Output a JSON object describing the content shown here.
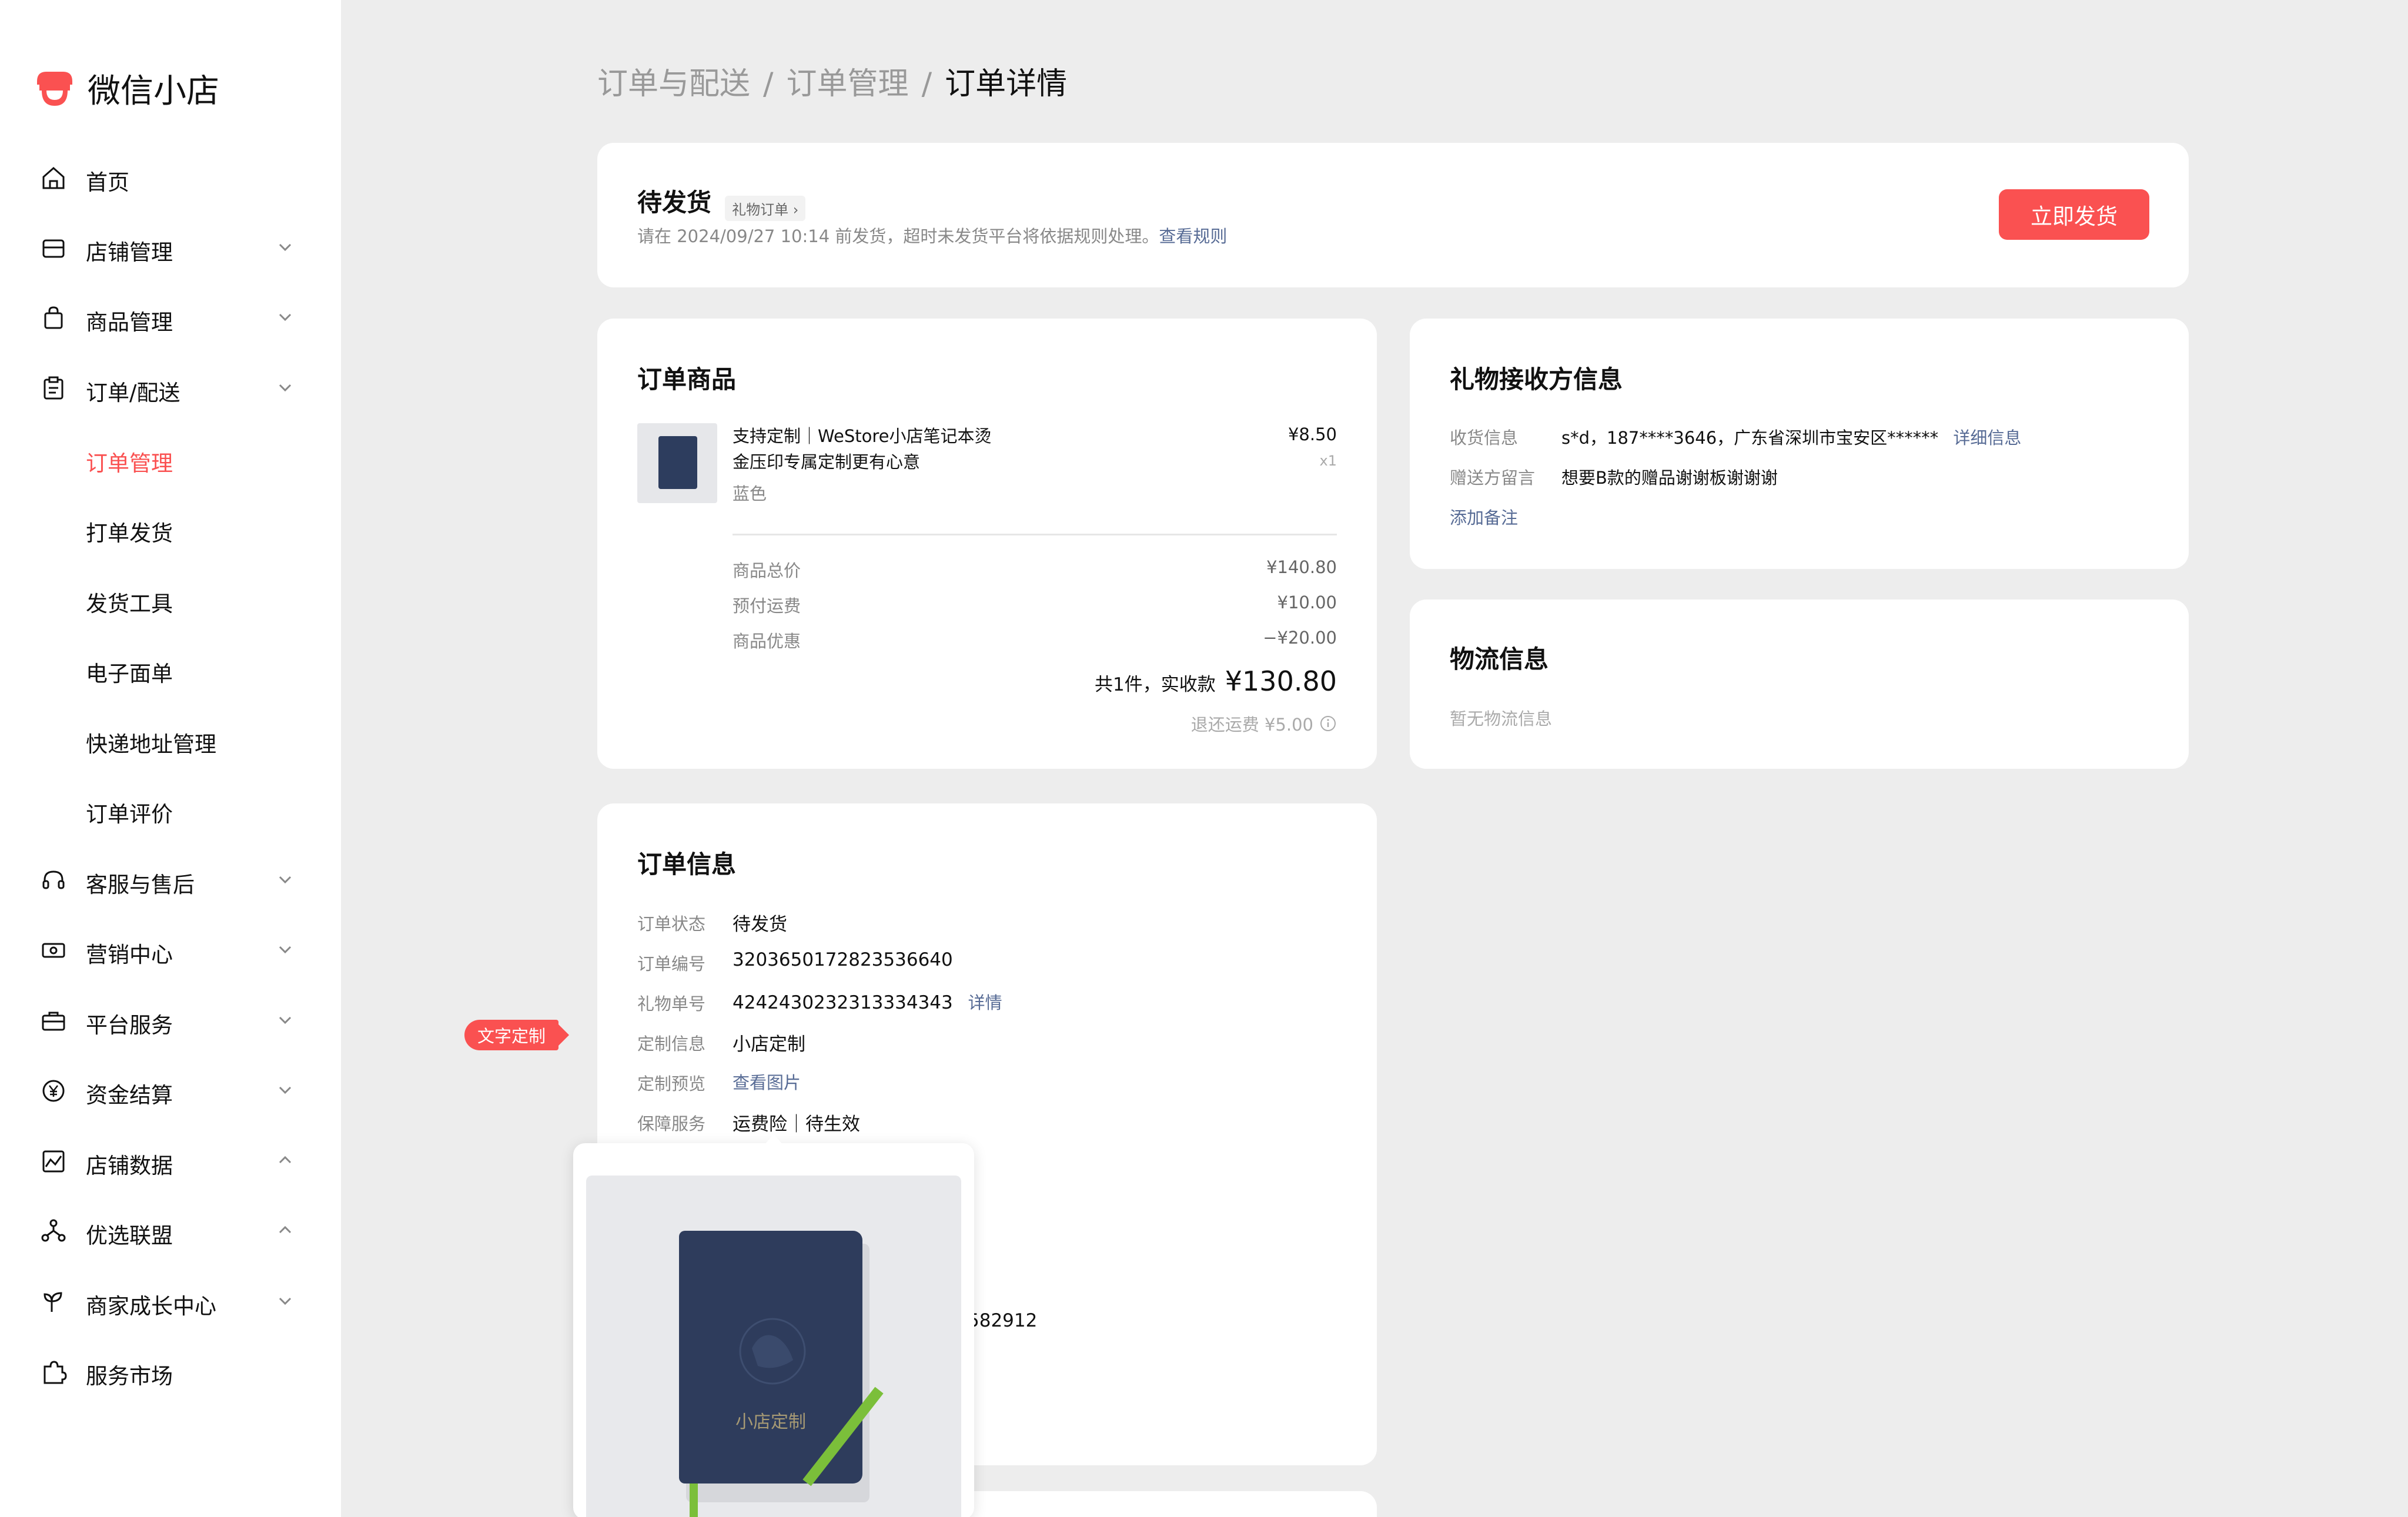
{
  "app": {
    "name": "微信小店"
  },
  "sidebar": {
    "items": [
      {
        "label": "首页",
        "icon": "home-icon"
      },
      {
        "label": "店铺管理",
        "icon": "store-icon"
      },
      {
        "label": "商品管理",
        "icon": "bag-icon"
      },
      {
        "label": "订单/配送",
        "icon": "clipboard-icon"
      },
      {
        "label": "订单管理"
      },
      {
        "label": "打单发货"
      },
      {
        "label": "发货工具"
      },
      {
        "label": "电子面单"
      },
      {
        "label": "快递地址管理"
      },
      {
        "label": "订单评价"
      },
      {
        "label": "客服与售后",
        "icon": "headset-icon"
      },
      {
        "label": "营销中心",
        "icon": "ticket-icon"
      },
      {
        "label": "平台服务",
        "icon": "briefcase-icon"
      },
      {
        "label": "资金结算",
        "icon": "yuan-icon"
      },
      {
        "label": "店铺数据",
        "icon": "chart-icon"
      },
      {
        "label": "优选联盟",
        "icon": "network-icon"
      },
      {
        "label": "商家成长中心",
        "icon": "sprout-icon"
      },
      {
        "label": "服务市场",
        "icon": "puzzle-icon"
      }
    ],
    "accent_color": "#fa5151"
  },
  "breadcrumb": {
    "items": [
      "订单与配送",
      "订单管理",
      "订单详情"
    ],
    "separator": "/"
  },
  "status_card": {
    "title": "待发货",
    "tag": "礼物订单",
    "notice": "请在 2024/09/27 10:14 前发货，超时未发货平台将依据规则处理。",
    "notice_link": "查看规则",
    "ship_button": "立即发货"
  },
  "order_goods": {
    "title": "订单商品",
    "product": {
      "name_line1": "支持定制｜WeStore小店笔记本烫",
      "name_line2": "金压印专属定制更有心意",
      "spec": "蓝色",
      "price": "¥8.50",
      "quantity": "x1"
    },
    "totals": [
      {
        "label": "商品总价",
        "value": "¥140.80"
      },
      {
        "label": "预付运费",
        "value": "¥10.00"
      },
      {
        "label": "商品优惠",
        "value": "−¥20.00"
      }
    ],
    "summary_label": "共1件，实收款",
    "summary_value": "¥130.80",
    "return_shipping": "退还运费 ¥5.00"
  },
  "recipient": {
    "title": "礼物接收方信息",
    "rows": [
      {
        "label": "收货信息",
        "value": "s*d，187****3646，广东省深圳市宝安区******",
        "link": "详细信息"
      },
      {
        "label": "赠送方留言",
        "value": "想要B款的赠品谢谢板谢谢谢"
      }
    ],
    "add_note": "添加备注"
  },
  "logistics": {
    "title": "物流信息",
    "empty": "暂无物流信息"
  },
  "order_info": {
    "title": "订单信息",
    "rows": [
      {
        "label": "订单状态",
        "value": "待发货"
      },
      {
        "label": "订单编号",
        "value": "3203650172823536640"
      },
      {
        "label": "礼物单号",
        "value": "4242430232313334343",
        "link": "详情"
      },
      {
        "label": "定制信息",
        "value": "小店定制"
      },
      {
        "label": "定制预览",
        "value": "查看图片"
      },
      {
        "label": "保障服务",
        "value": "运费险｜待生效"
      }
    ],
    "partial_value": "582912"
  },
  "badge": {
    "label": "文字定制"
  },
  "preview_popup": {
    "emboss_text": "小店定制"
  }
}
